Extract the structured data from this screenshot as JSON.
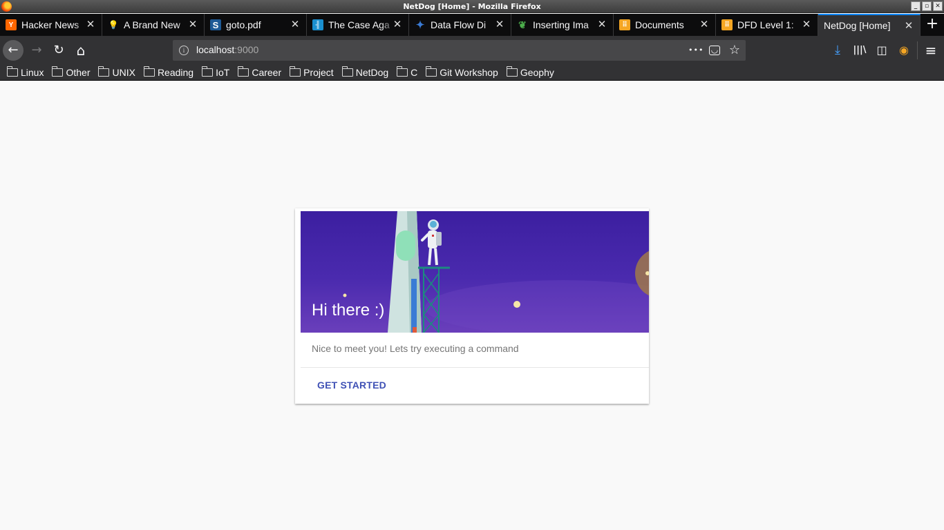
{
  "window": {
    "title": "NetDog [Home] - Mozilla Firefox"
  },
  "tabs": [
    {
      "label": "Hacker News",
      "favicon": "hacker-news-icon",
      "favicon_glyph": "Y",
      "favicon_color": "#ff6600"
    },
    {
      "label": "A Brand New",
      "favicon": "lightbulb-icon",
      "favicon_glyph": "💡",
      "favicon_color": "transparent"
    },
    {
      "label": "goto.pdf",
      "favicon": "scribd-icon",
      "favicon_glyph": "S",
      "favicon_color": "#1e5a96"
    },
    {
      "label": "The Case Aga",
      "favicon": "site-icon",
      "favicon_glyph": "╢",
      "favicon_color": "#1a8fcf"
    },
    {
      "label": "Data Flow Di",
      "favicon": "diagram-icon",
      "favicon_glyph": "✦",
      "favicon_color": "#3a7bd5"
    },
    {
      "label": "Inserting Ima",
      "favicon": "overleaf-icon",
      "favicon_glyph": "❦",
      "favicon_color": "transparent"
    },
    {
      "label": "Documents",
      "favicon": "documents-icon",
      "favicon_glyph": "⠿",
      "favicon_color": "#f5a623"
    },
    {
      "label": "DFD Level 1:",
      "favicon": "documents-icon",
      "favicon_glyph": "⠿",
      "favicon_color": "#f5a623"
    },
    {
      "label": "NetDog [Home]",
      "favicon": "",
      "favicon_glyph": "",
      "favicon_color": "transparent",
      "active": true
    }
  ],
  "tab_close_glyph": "✕",
  "new_tab_glyph": "+",
  "nav": {
    "back_glyph": "←",
    "forward_glyph": "→",
    "reload_glyph": "↻",
    "home_glyph": "⌂",
    "url_host": "localhost",
    "url_port": ":9000",
    "page_actions_glyph": "•••",
    "pocket_glyph": "◡",
    "star_glyph": "☆",
    "downloads_glyph": "⤓",
    "library_glyph": "|||\\",
    "sidebar_glyph": "◫",
    "extension_glyph": "◉",
    "menu_glyph": "≡"
  },
  "bookmarks": [
    "Linux",
    "Other",
    "UNIX",
    "Reading",
    "IoT",
    "Career",
    "Project",
    "NetDog",
    "C",
    "Git Workshop",
    "Geophy"
  ],
  "card": {
    "title": "Hi there :)",
    "supporting_text": "Nice to meet you! Lets try executing a command",
    "action_label": "GET STARTED"
  },
  "colors": {
    "accent": "#0a84ff",
    "card_action": "#3f51b5",
    "hero_bg": "#4a2aae"
  }
}
